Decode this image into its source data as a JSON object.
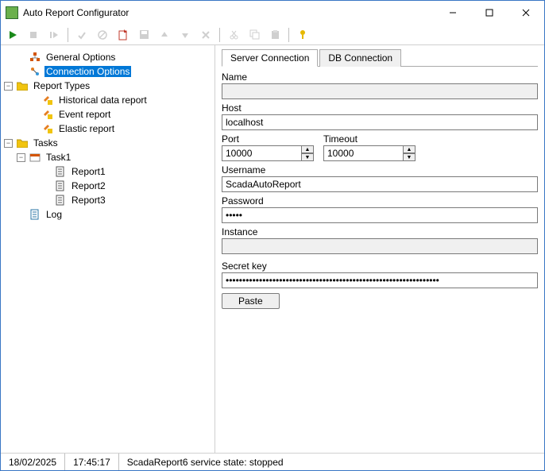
{
  "window": {
    "title": "Auto Report Configurator"
  },
  "tree": {
    "general_options": "General Options",
    "connection_options": "Connection Options",
    "report_types": "Report Types",
    "historical": "Historical data report",
    "event": "Event report",
    "elastic": "Elastic report",
    "tasks": "Tasks",
    "task1": "Task1",
    "report1": "Report1",
    "report2": "Report2",
    "report3": "Report3",
    "log": "Log"
  },
  "tabs": {
    "server": "Server Connection",
    "db": "DB Connection"
  },
  "form": {
    "name_label": "Name",
    "name_value": "",
    "host_label": "Host",
    "host_value": "localhost",
    "port_label": "Port",
    "port_value": "10000",
    "timeout_label": "Timeout",
    "timeout_value": "10000",
    "username_label": "Username",
    "username_value": "ScadaAutoReport",
    "password_label": "Password",
    "password_value": "•••••",
    "instance_label": "Instance",
    "instance_value": "",
    "secret_label": "Secret key",
    "secret_value": "••••••••••••••••••••••••••••••••••••••••••••••••••••••••••••••••",
    "paste_label": "Paste"
  },
  "status": {
    "date": "18/02/2025",
    "time": "17:45:17",
    "msg": "ScadaReport6 service state: stopped"
  }
}
